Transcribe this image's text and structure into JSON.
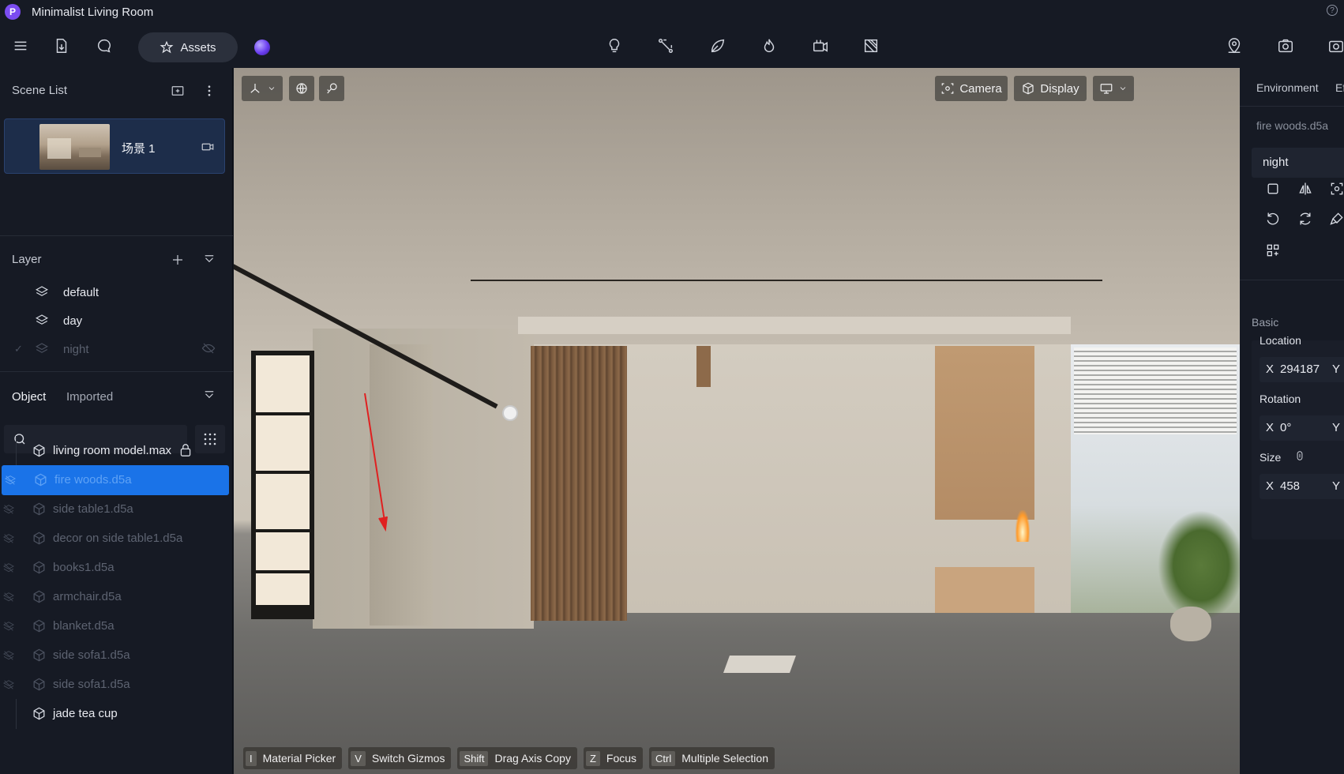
{
  "window": {
    "title": "Minimalist Living Room",
    "logo_letter": "P",
    "help": "?"
  },
  "toolbar": {
    "assets_label": "Assets"
  },
  "scene_list": {
    "title": "Scene List",
    "scenes": [
      {
        "name": "场景 1"
      }
    ]
  },
  "layer": {
    "title": "Layer",
    "items": [
      {
        "name": "default"
      },
      {
        "name": "day"
      },
      {
        "name": "night"
      }
    ],
    "check": "✓"
  },
  "objects": {
    "tabs": [
      {
        "label": "Object"
      },
      {
        "label": "Imported"
      }
    ],
    "search_placeholder": "",
    "items": [
      {
        "name": "living room model.max"
      },
      {
        "name": "fire woods.d5a"
      },
      {
        "name": "side table1.d5a"
      },
      {
        "name": "decor on side table1.d5a"
      },
      {
        "name": "books1.d5a"
      },
      {
        "name": "armchair.d5a"
      },
      {
        "name": "blanket.d5a"
      },
      {
        "name": "side sofa1.d5a"
      },
      {
        "name": "side sofa1.d5a"
      },
      {
        "name": "jade tea cup"
      }
    ]
  },
  "viewport": {
    "camera_label": "Camera",
    "display_label": "Display",
    "shortcuts": [
      {
        "key": "I",
        "label": "Material Picker"
      },
      {
        "key": "V",
        "label": "Switch Gizmos"
      },
      {
        "key": "Shift",
        "label": "Drag Axis Copy"
      },
      {
        "key": "Z",
        "label": "Focus"
      },
      {
        "key": "Ctrl",
        "label": "Multiple Selection"
      }
    ]
  },
  "right_panel": {
    "tabs": [
      {
        "label": "Environment"
      },
      {
        "label": "Ef"
      }
    ],
    "object_name": "fire woods.d5a",
    "layer_value": "night",
    "basic": "Basic",
    "location": {
      "label": "Location",
      "x_axis": "X",
      "x_value": "294187",
      "y_axis": "Y"
    },
    "rotation": {
      "label": "Rotation",
      "x_axis": "X",
      "x_value": "0°",
      "y_axis": "Y"
    },
    "size": {
      "label": "Size",
      "x_axis": "X",
      "x_value": "458",
      "y_axis": "Y"
    }
  },
  "colors": {
    "panel_bg": "#161a24",
    "accent_blue": "#1a73e8",
    "selected_text": "#5fa2f5",
    "brand_purple": "#7b4cf0",
    "annotation_red": "#e02020"
  },
  "icons": {
    "toolbar_left": [
      "menu-icon",
      "import-file-icon",
      "comment-icon"
    ],
    "toolbar_center": [
      "light-icon",
      "path-tool-icon",
      "vegetation-icon",
      "fire-effect-icon",
      "video-icon",
      "section-box-icon"
    ],
    "toolbar_right": [
      "location-pin-icon",
      "render-camera-icon",
      "screenshot-icon"
    ]
  }
}
